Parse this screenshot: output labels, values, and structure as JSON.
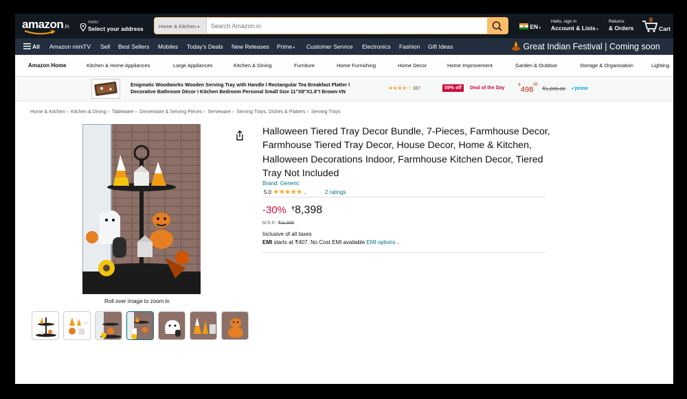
{
  "header": {
    "logo_text": "amazon",
    "logo_suffix": ".in",
    "location_line1": "Hello",
    "location_line2": "Select your address",
    "search_dept": "Home & Kitchen",
    "search_placeholder": "Search Amazon.in",
    "lang": "EN",
    "account_line1": "Hello, sign in",
    "account_line2": "Account & Lists",
    "returns_line1": "Returns",
    "returns_line2": "& Orders",
    "cart_count": "0",
    "cart_label": "Cart"
  },
  "nav": {
    "all_label": "All",
    "items": [
      "Amazon miniTV",
      "Sell",
      "Best Sellers",
      "Mobiles",
      "Today's Deals",
      "New Releases",
      "Prime",
      "Customer Service",
      "Electronics",
      "Fashion",
      "Gift Ideas"
    ],
    "festival": "Great Indian Festival | Coming soon"
  },
  "categories": {
    "home_label": "Amazon Home",
    "items": [
      "Kitchen & Home Appliances",
      "Large Appliances",
      "Kitchen & Dining",
      "Furniture",
      "Home Furnishing",
      "Home Decor",
      "Home Improvement",
      "Garden & Outdoor",
      "Storage & Organisation",
      "Lighting"
    ]
  },
  "promo": {
    "title_line1": "Enigmatic Woodworks Wooden Serving Tray with Handle I Rectangular Tea Breakfast Platter I",
    "title_line2": "Decorative Bathroom Décor I Kitchen Bedroom Personal Small Size 11\"X8\"X1.8\"I Brown-VN",
    "rating_count": "387",
    "discount_badge": "59% off",
    "deal_label": "Deal of the Day",
    "price_symbol": "₹",
    "price_whole": "498",
    "price_fraction": "00",
    "mrp": "₹1,200.00",
    "prime": "✓prime"
  },
  "breadcrumb": [
    "Home & Kitchen",
    "Kitchen & Dining",
    "Tableware",
    "Dinnerware & Serving Pieces",
    "Serveware",
    "Serving Trays, Dishes & Platters",
    "Serving Trays"
  ],
  "product": {
    "title": "Halloween Tiered Tray Decor Bundle, 7-Pieces, Farmhouse Decor, Farmhouse Tiered Tray Decor, House Decor, Home & Kitchen, Halloween Decorations Indoor, Farmhouse Kitchen Decor, Tiered Tray Not Included",
    "brand": "Brand: Generic",
    "rating_value": "5.0",
    "ratings_link": "2 ratings",
    "discount": "-30%",
    "price_symbol": "₹",
    "price": "8,398",
    "mrp_label": "M.R.P.:",
    "mrp_value": "₹11,999",
    "tax_note": "Inclusive of all taxes",
    "emi_bold": "EMI",
    "emi_text": " starts at ₹407. No Cost EMI available ",
    "emi_link": "EMI options",
    "zoom_hint": "Roll over image to zoom in"
  },
  "colors": {
    "header_bg": "#131921",
    "nav_bg": "#232f3e",
    "search_button": "#febd69",
    "link": "#007185",
    "discount": "#cc0c39",
    "deal_badge": "#cc0c39",
    "star": "#ffa41c"
  }
}
